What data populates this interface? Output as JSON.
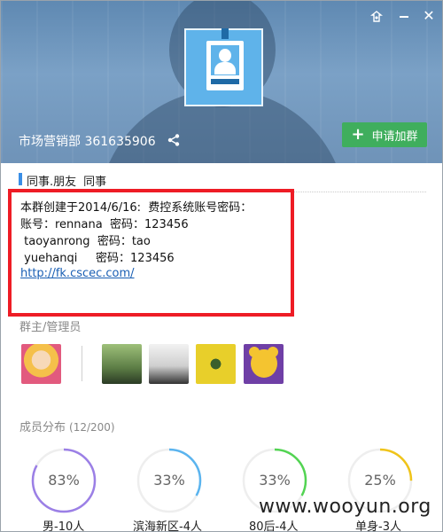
{
  "header": {
    "group_name": "市场营销部",
    "group_id": "361635906",
    "join_button_label": "申请加群"
  },
  "tags": [
    "同事.朋友",
    "同事"
  ],
  "announcement": {
    "lines": [
      "本群创建于2014/6/16:  费控系统账号密码：",
      "账号：rennana  密码：123456",
      " taoyanrong  密码：tao",
      " yuehanqi     密码：123456"
    ],
    "link": "http://fk.cscec.com/"
  },
  "admins": {
    "label": "群主/管理员"
  },
  "member_stats": {
    "title": "成员分布",
    "count": "(12/200)",
    "items": [
      {
        "value": "83%",
        "label": "男-10人",
        "fraction": 0.83,
        "color": "#9b7fe6"
      },
      {
        "value": "33%",
        "label": "滨海新区-4人",
        "fraction": 0.33,
        "color": "#5ab4ef"
      },
      {
        "value": "33%",
        "label": "80后-4人",
        "fraction": 0.33,
        "color": "#52d452"
      },
      {
        "value": "25%",
        "label": "单身-3人",
        "fraction": 0.25,
        "color": "#f0c419"
      }
    ]
  },
  "watermark": "www.wooyun.org",
  "icons": {
    "skin": "skin-icon",
    "minimize": "minimize-icon",
    "close": "close-icon",
    "share": "share-icon",
    "plus": "plus-icon"
  }
}
